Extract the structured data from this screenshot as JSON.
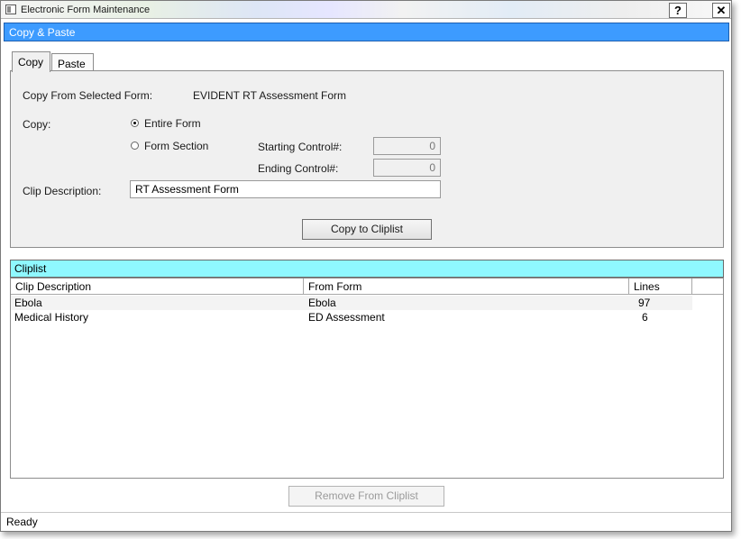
{
  "window": {
    "title": "Electronic Form Maintenance",
    "help_label": "?",
    "close_label": "✕"
  },
  "section": {
    "title": "Copy & Paste"
  },
  "tabs": [
    {
      "label": "Copy"
    },
    {
      "label": "Paste"
    }
  ],
  "copy_panel": {
    "from_label": "Copy From Selected Form:",
    "from_value": "EVIDENT RT Assessment Form",
    "copy_label": "Copy:",
    "option_entire": "Entire Form",
    "option_section": "Form Section",
    "starting_label": "Starting Control#:",
    "starting_value": "0",
    "ending_label": "Ending Control#:",
    "ending_value": "0",
    "clip_desc_label": "Clip Description:",
    "clip_desc_value": "RT Assessment Form",
    "copy_button": "Copy to Cliplist"
  },
  "cliplist": {
    "title": "Cliplist",
    "columns": [
      "Clip Description",
      "From Form",
      "Lines"
    ],
    "rows": [
      {
        "desc": "Ebola",
        "from": "Ebola",
        "lines": "97"
      },
      {
        "desc": "Medical History",
        "from": "ED Assessment",
        "lines": "6"
      }
    ],
    "remove_button": "Remove From Cliplist"
  },
  "status": {
    "text": "Ready"
  },
  "colors": {
    "header_blue": "#3d9bff",
    "cliplist_cyan": "#8ff8ff"
  }
}
